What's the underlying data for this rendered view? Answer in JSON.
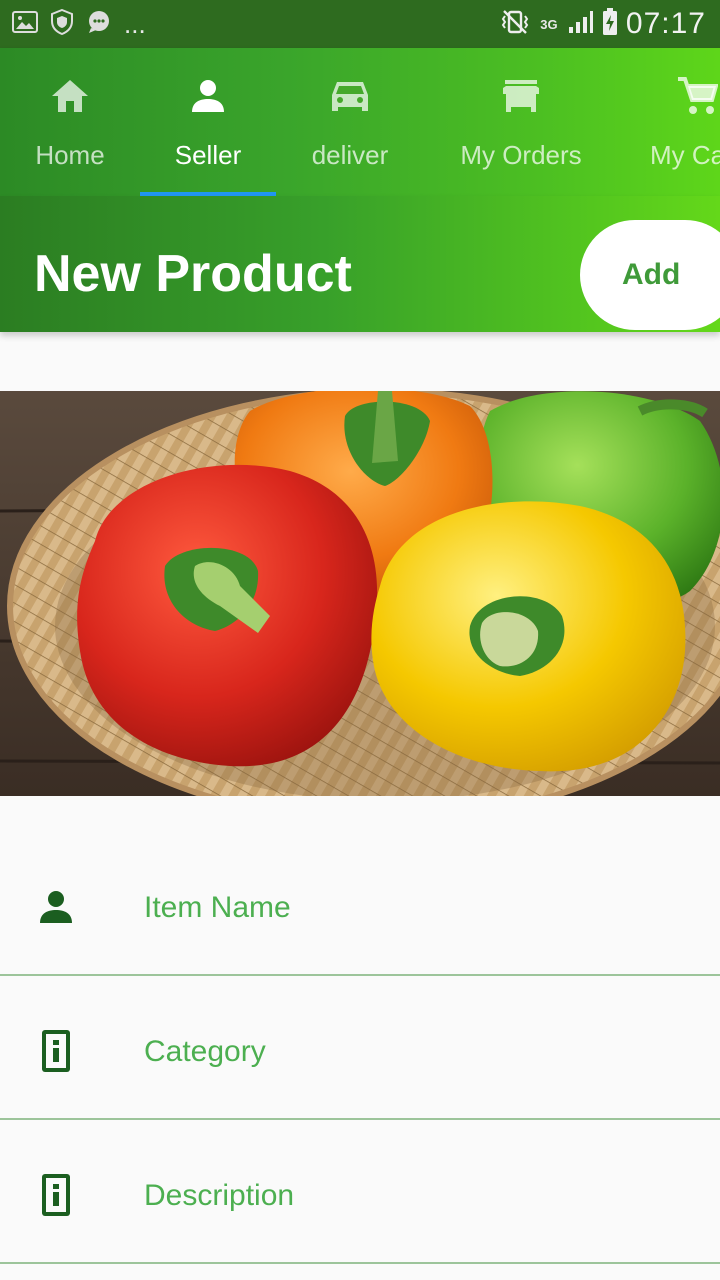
{
  "status_bar": {
    "time": "07:17",
    "network": "3G",
    "overflow": "...",
    "icons": [
      "image-icon",
      "shield-icon",
      "chat-icon",
      "vibrate-icon",
      "signal-icon",
      "battery-charging-icon"
    ]
  },
  "tabs": [
    {
      "label": "Home",
      "icon": "home-icon",
      "active": false
    },
    {
      "label": "Seller",
      "icon": "person-icon",
      "active": true
    },
    {
      "label": "deliver",
      "icon": "car-icon",
      "active": false
    },
    {
      "label": "My Orders",
      "icon": "store-icon",
      "active": false
    },
    {
      "label": "My Ca",
      "icon": "cart-icon",
      "active": false
    }
  ],
  "header": {
    "title": "New Product",
    "add_label": "Add"
  },
  "product_image": {
    "subject": "bell peppers in a wicker basket",
    "colors": {
      "red": "#d8261c",
      "orange": "#f07a12",
      "yellow": "#f5c800",
      "green": "#5bb22a",
      "basket": "#d9b98a",
      "wood": "#4a3a2e"
    }
  },
  "form": {
    "fields": [
      {
        "label": "Item Name",
        "icon": "person-icon"
      },
      {
        "label": "Category",
        "icon": "info-icon"
      },
      {
        "label": "Description",
        "icon": "info-icon"
      }
    ]
  },
  "colors": {
    "accent_green": "#4caf50",
    "dark_green": "#1b5e20",
    "tab_indicator": "#2196f3",
    "status_bar": "#2e6b1f"
  }
}
